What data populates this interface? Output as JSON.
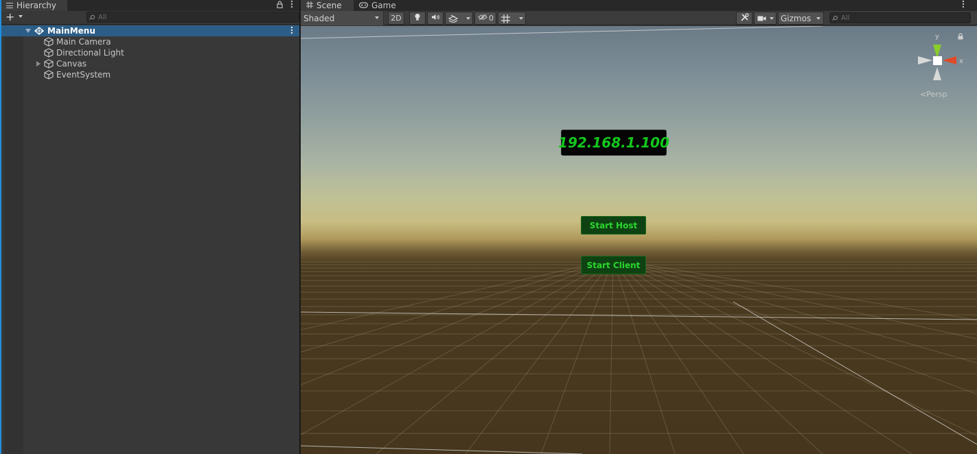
{
  "hierarchy": {
    "tab_label": "Hierarchy",
    "add_label": "+",
    "search_placeholder": "All",
    "items": [
      {
        "label": "MainMenu",
        "selected": true
      },
      {
        "label": "Main Camera"
      },
      {
        "label": "Directional Light"
      },
      {
        "label": "Canvas"
      },
      {
        "label": "EventSystem"
      }
    ]
  },
  "scene_view": {
    "tabs": [
      {
        "label": "Scene"
      },
      {
        "label": "Game"
      }
    ],
    "shading_mode": "Shaded",
    "mode_2d_label": "2D",
    "hidden_count": "0",
    "gizmos_label": "Gizmos",
    "search_placeholder": "All",
    "persp_label": "Persp",
    "axis_labels": {
      "y": "y",
      "x": "x"
    }
  },
  "scene_content": {
    "ip_text": "192.168.1.100",
    "start_host_label": "Start Host",
    "start_client_label": "Start Client"
  },
  "colors": {
    "accent": "#2c5d87",
    "selection_border": "#1e90e0",
    "ui_text_green": "#14c81e",
    "gizmo_y": "#8acc2a",
    "gizmo_x": "#e04a28"
  }
}
